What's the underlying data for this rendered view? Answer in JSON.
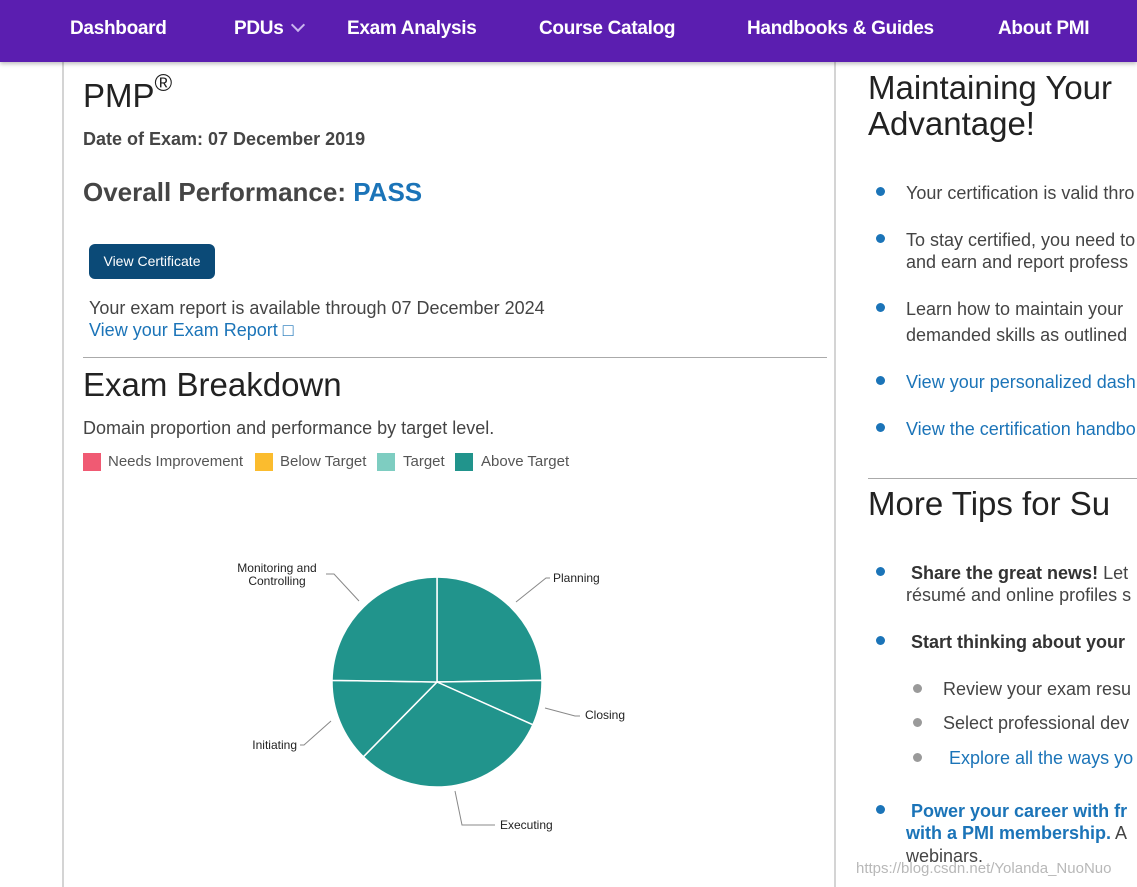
{
  "nav": {
    "items": [
      {
        "label": "Dashboard"
      },
      {
        "label": "PDUs"
      },
      {
        "label": "Exam Analysis"
      },
      {
        "label": "Course Catalog"
      },
      {
        "label": "Handbooks & Guides"
      },
      {
        "label": "About PMI"
      }
    ]
  },
  "exam": {
    "title": "PMP",
    "title_mark": "®",
    "date": "Date of Exam: 07 December 2019",
    "overall_label": "Overall Performance:",
    "overall_result": "PASS",
    "certificate_button": "View Certificate",
    "availability": "Your exam report is available through 07 December 2024",
    "report_link": "View your Exam Report □"
  },
  "breakdown": {
    "heading": "Exam Breakdown",
    "description": "Domain proportion and performance by target level.",
    "legend": [
      {
        "label": "Needs Improvement",
        "color": "#f05a73"
      },
      {
        "label": "Below Target",
        "color": "#fbbc2e"
      },
      {
        "label": "Target",
        "color": "#7ecdc1"
      },
      {
        "label": "Above Target",
        "color": "#21948c"
      }
    ]
  },
  "chart_data": {
    "type": "pie",
    "title": "",
    "slices": [
      {
        "label": "Planning",
        "value": 25,
        "level": "Above Target",
        "color": "#21948c"
      },
      {
        "label": "Closing",
        "value": 7,
        "level": "Above Target",
        "color": "#21948c"
      },
      {
        "label": "Executing",
        "value": 31,
        "level": "Above Target",
        "color": "#21948c"
      },
      {
        "label": "Initiating",
        "value": 13,
        "level": "Above Target",
        "color": "#21948c"
      },
      {
        "label": "Monitoring and Controlling",
        "value": 25,
        "level": "Above Target",
        "color": "#21948c"
      }
    ]
  },
  "right": {
    "heading1_line1": "Maintaining Your",
    "heading1_line2": "Advantage!",
    "bullet1": "Your certification is valid thro",
    "bullet2_line1": "To stay certified, you need to",
    "bullet2_line2": "and earn and report profess",
    "bullet3_line1": "Learn how to maintain your",
    "bullet3_line2": "demanded skills as outlined",
    "link1": "View your personalized dash",
    "link2": "View the certification handbo",
    "heading2": "More Tips for Su",
    "tip1_bold": "Share the great news!",
    "tip1_rest": " Let",
    "tip1_line2": "résumé and online profiles s",
    "tip2_bold": "Start thinking about your",
    "sub1": "Review your exam resu",
    "sub2": "Select professional dev",
    "sub3": "Explore all the ways yo",
    "tip3_line1": "Power your career with fr",
    "tip3_line2_bold": "with a PMI membership.",
    "tip3_line2_rest": " A",
    "tip3_line3": "webinars."
  },
  "watermark": "https://blog.csdn.net/Yolanda_NuoNuo"
}
